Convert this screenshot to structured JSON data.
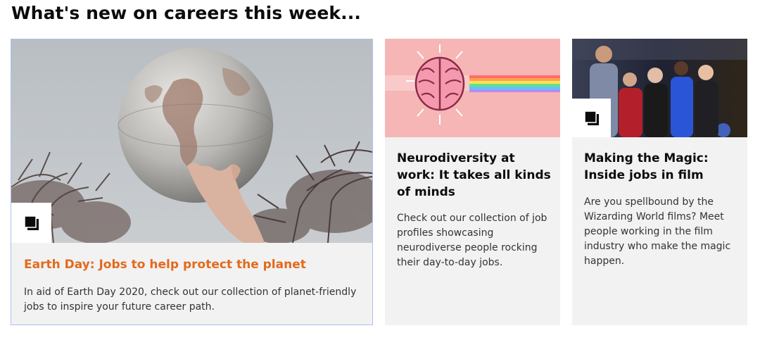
{
  "section": {
    "heading": "What's new on careers this week..."
  },
  "cards": [
    {
      "title": "Earth Day: Jobs to help protect the planet",
      "description": "In aid of Earth Day 2020, check out our collection of planet-friendly jobs to inspire your future career path.",
      "badge_icon": "collection-icon",
      "title_color": "#e36a1c"
    },
    {
      "title": "Neurodiversity at work: It takes all kinds of minds",
      "description": "Check out our collection of job profiles showcasing neurodiverse people rocking their day-to-day jobs."
    },
    {
      "title": "Making the Magic: Inside jobs in film",
      "description": "Are you spellbound by the Wizarding World films? Meet people working in the film industry who make the magic happen.",
      "badge_icon": "collection-icon"
    }
  ]
}
